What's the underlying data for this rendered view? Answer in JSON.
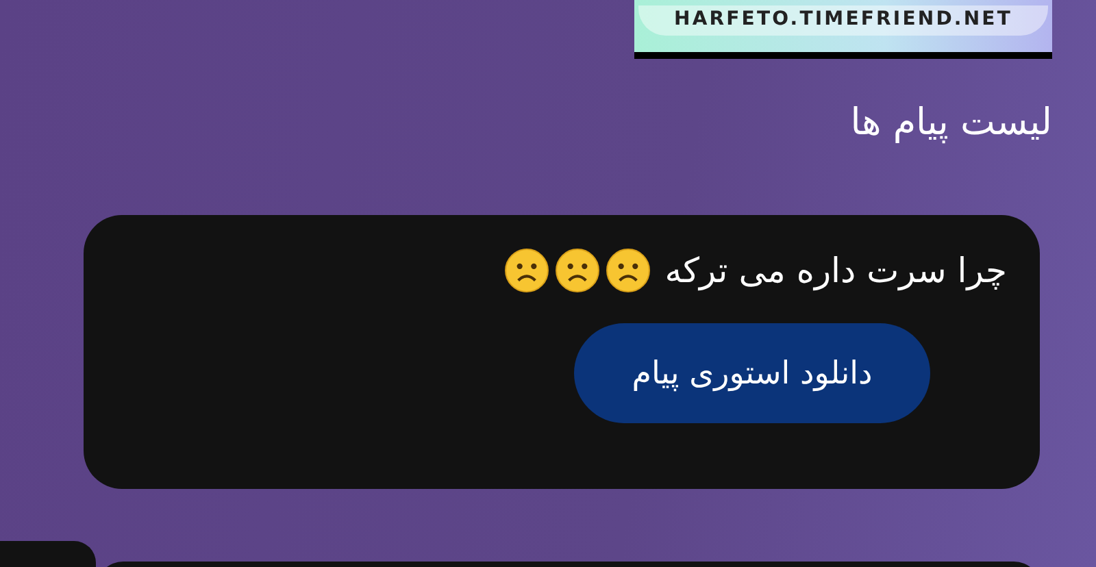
{
  "banner": {
    "site": "HARFETO.TIMEFRIEND.NET"
  },
  "heading": "لیست پیام ها",
  "messages": [
    {
      "text": "چرا سرت داره می ترکه",
      "button": "دانلود استوری پیام"
    }
  ]
}
